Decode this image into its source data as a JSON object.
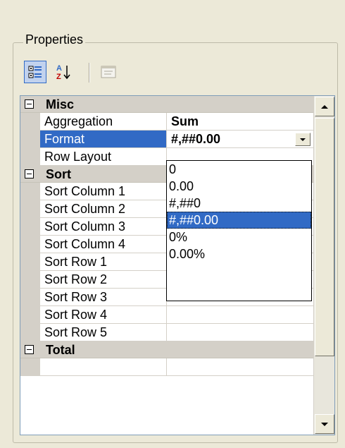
{
  "panel": {
    "title": "Properties"
  },
  "toolbar": {
    "buttons": [
      {
        "name": "categorized-icon",
        "pressed": true
      },
      {
        "name": "alphabetical-sort-icon",
        "pressed": false
      },
      {
        "name": "property-pages-icon",
        "pressed": false,
        "disabled": true
      }
    ],
    "az_top": "A",
    "az_bottom": "Z"
  },
  "grid": {
    "misc": {
      "label": "Misc",
      "aggregation": {
        "name": "Aggregation",
        "value": "Sum"
      },
      "format": {
        "name": "Format",
        "value": "#,##0.00"
      },
      "row_layout": {
        "name": "Row Layout",
        "value": ""
      }
    },
    "sort": {
      "label": "Sort",
      "rows": [
        {
          "name": "Sort Column 1",
          "value": ""
        },
        {
          "name": "Sort Column 2",
          "value": ""
        },
        {
          "name": "Sort Column 3",
          "value": ""
        },
        {
          "name": "Sort Column 4",
          "value": ""
        },
        {
          "name": "Sort Row 1",
          "value": ""
        },
        {
          "name": "Sort Row 2",
          "value": ""
        },
        {
          "name": "Sort Row 3",
          "value": ""
        },
        {
          "name": "Sort Row 4",
          "value": ""
        },
        {
          "name": "Sort Row 5",
          "value": ""
        }
      ]
    },
    "total": {
      "label": "Total"
    }
  },
  "format_dropdown": {
    "options": [
      "0",
      "0.00",
      "#,##0",
      "#,##0.00",
      "0%",
      "0.00%"
    ],
    "selected": "#,##0.00"
  },
  "colors": {
    "selection": "#316ac5",
    "category_bg": "#d4d0c8",
    "window_bg": "#ece9d8"
  }
}
